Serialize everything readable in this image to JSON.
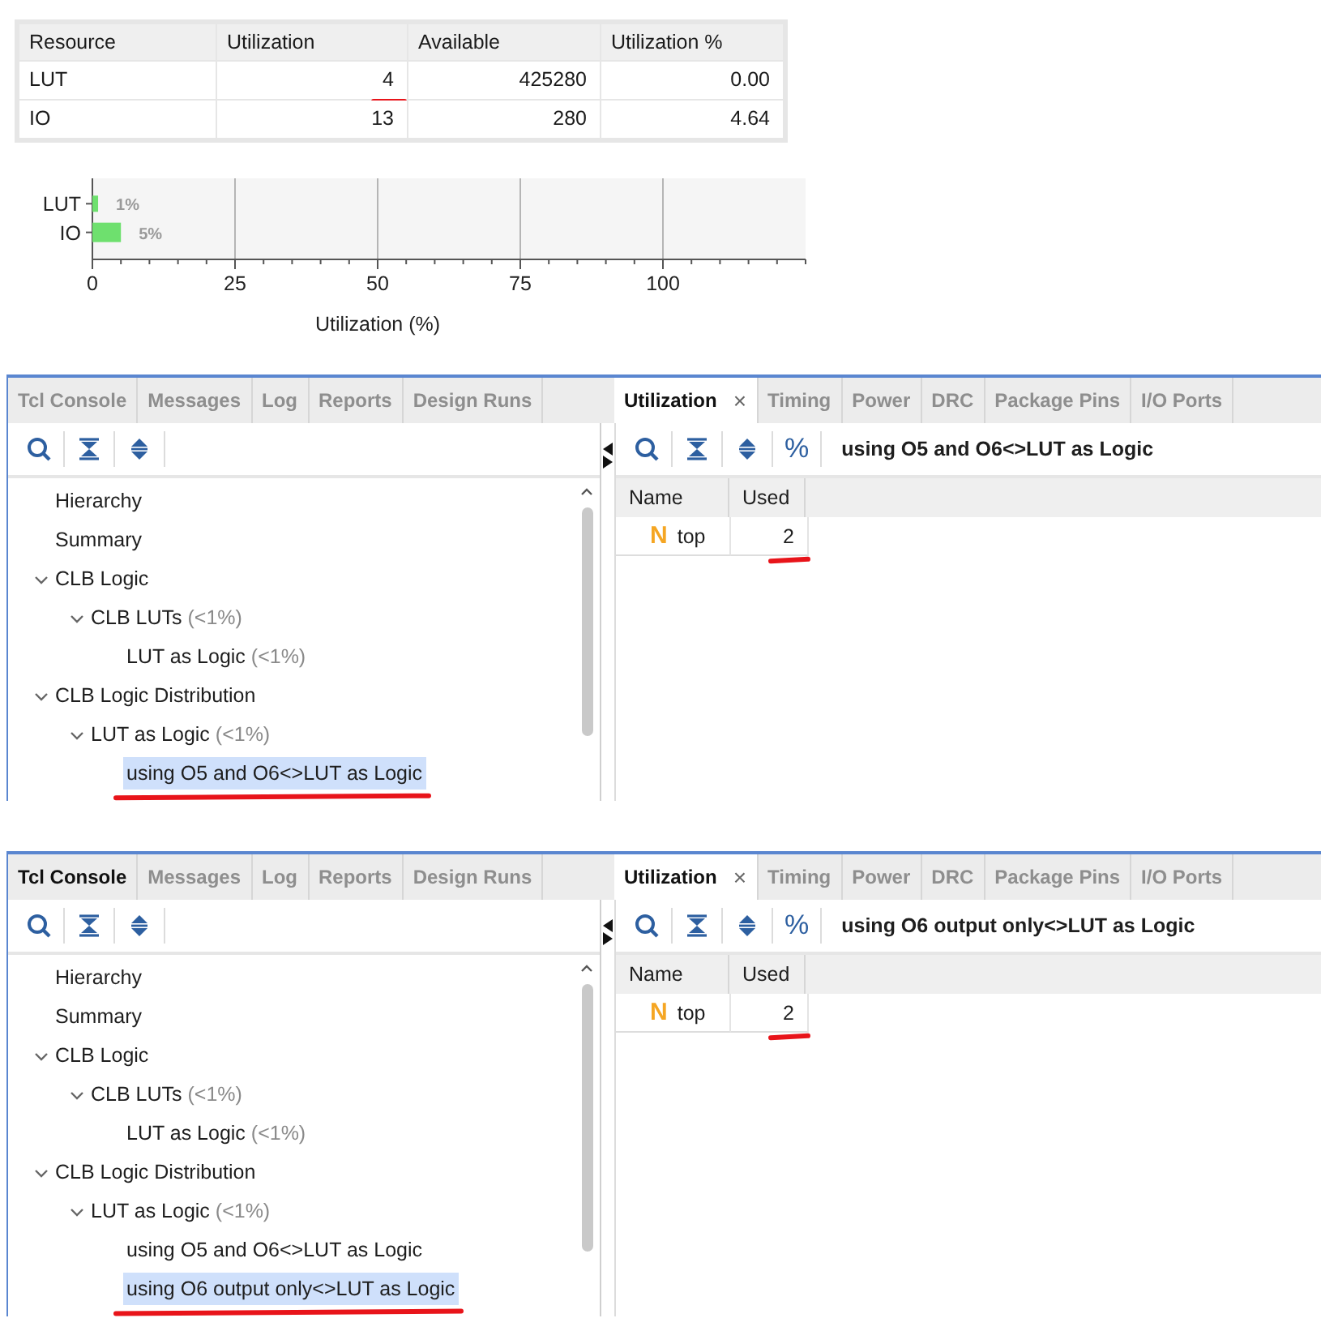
{
  "resource_table": {
    "columns": [
      "Resource",
      "Utilization",
      "Available",
      "Utilization %"
    ],
    "rows": [
      {
        "resource": "LUT",
        "utilization": "4",
        "available": "425280",
        "percent": "0.00",
        "utilization_underlined": true
      },
      {
        "resource": "IO",
        "utilization": "13",
        "available": "280",
        "percent": "4.64",
        "utilization_underlined": false
      }
    ]
  },
  "chart": {
    "chart_data": {
      "type": "bar",
      "orientation": "horizontal",
      "categories": [
        "LUT",
        "IO"
      ],
      "values": [
        1,
        5
      ],
      "grid": true,
      "value_labels": [
        "1%",
        "5%"
      ],
      "xlabel": "Utilization (%)",
      "xlim": [
        0,
        125
      ],
      "xticks": [
        0,
        25,
        50,
        75,
        100
      ]
    }
  },
  "panels": [
    {
      "left_tabs": [
        {
          "label": "Tcl Console",
          "selected": false,
          "highlighted": false
        },
        {
          "label": "Messages",
          "selected": false,
          "highlighted": false
        },
        {
          "label": "Log",
          "selected": false,
          "highlighted": false
        },
        {
          "label": "Reports",
          "selected": false,
          "highlighted": false
        },
        {
          "label": "Design Runs",
          "selected": false,
          "highlighted": false
        }
      ],
      "right_tabs": [
        {
          "label": "Utilization",
          "selected": true,
          "highlighted": true,
          "close": "×"
        },
        {
          "label": "Timing",
          "selected": false,
          "highlighted": false
        },
        {
          "label": "Power",
          "selected": false,
          "highlighted": false
        },
        {
          "label": "DRC",
          "selected": false,
          "highlighted": false
        },
        {
          "label": "Package Pins",
          "selected": false,
          "highlighted": false
        },
        {
          "label": "I/O Ports",
          "selected": false,
          "highlighted": false
        }
      ],
      "tree": [
        {
          "label": "Hierarchy",
          "selected": false,
          "underlined": false
        },
        {
          "label": "Summary",
          "selected": false,
          "underlined": false
        },
        {
          "label": "CLB Logic",
          "expanded": true,
          "selected": false,
          "underlined": false,
          "children": [
            {
              "label": "CLB LUTs",
              "note": "(<1%)",
              "expanded": true,
              "selected": false,
              "underlined": false,
              "children": [
                {
                  "label": "LUT as Logic",
                  "note": "(<1%)",
                  "selected": false,
                  "underlined": false
                }
              ]
            }
          ]
        },
        {
          "label": "CLB Logic Distribution",
          "expanded": true,
          "selected": false,
          "underlined": false,
          "children": [
            {
              "label": "LUT as Logic",
              "note": "(<1%)",
              "expanded": true,
              "selected": false,
              "underlined": false,
              "children": [
                {
                  "label": "using O5 and O6<>LUT as Logic",
                  "selected": true,
                  "underlined": true
                }
              ]
            }
          ]
        }
      ],
      "percent_button": "%",
      "title": "using O5 and O6<>LUT as Logic",
      "table": {
        "columns": [
          "Name",
          "Used"
        ],
        "rows": [
          {
            "icon": "N",
            "name": "top",
            "used": "2",
            "used_underlined": true
          }
        ]
      }
    },
    {
      "left_tabs": [
        {
          "label": "Tcl Console",
          "selected": false,
          "highlighted": true
        },
        {
          "label": "Messages",
          "selected": false,
          "highlighted": false
        },
        {
          "label": "Log",
          "selected": false,
          "highlighted": false
        },
        {
          "label": "Reports",
          "selected": false,
          "highlighted": false
        },
        {
          "label": "Design Runs",
          "selected": false,
          "highlighted": false
        }
      ],
      "right_tabs": [
        {
          "label": "Utilization",
          "selected": true,
          "highlighted": true,
          "close": "×"
        },
        {
          "label": "Timing",
          "selected": false,
          "highlighted": false
        },
        {
          "label": "Power",
          "selected": false,
          "highlighted": false
        },
        {
          "label": "DRC",
          "selected": false,
          "highlighted": false
        },
        {
          "label": "Package Pins",
          "selected": false,
          "highlighted": false
        },
        {
          "label": "I/O Ports",
          "selected": false,
          "highlighted": false
        }
      ],
      "tree": [
        {
          "label": "Hierarchy",
          "selected": false,
          "underlined": false
        },
        {
          "label": "Summary",
          "selected": false,
          "underlined": false
        },
        {
          "label": "CLB Logic",
          "expanded": true,
          "selected": false,
          "underlined": false,
          "children": [
            {
              "label": "CLB LUTs",
              "note": "(<1%)",
              "expanded": true,
              "selected": false,
              "underlined": false,
              "children": [
                {
                  "label": "LUT as Logic",
                  "note": "(<1%)",
                  "selected": false,
                  "underlined": false
                }
              ]
            }
          ]
        },
        {
          "label": "CLB Logic Distribution",
          "expanded": true,
          "selected": false,
          "underlined": false,
          "children": [
            {
              "label": "LUT as Logic",
              "note": "(<1%)",
              "expanded": true,
              "selected": false,
              "underlined": false,
              "children": [
                {
                  "label": "using O5 and O6<>LUT as Logic",
                  "selected": false,
                  "underlined": false
                },
                {
                  "label": "using O6 output only<>LUT as Logic",
                  "selected": true,
                  "underlined": true
                }
              ]
            }
          ]
        }
      ],
      "percent_button": "%",
      "title": "using O6 output only<>LUT as Logic",
      "table": {
        "columns": [
          "Name",
          "Used"
        ],
        "rows": [
          {
            "icon": "N",
            "name": "top",
            "used": "2",
            "used_underlined": true
          }
        ]
      }
    }
  ]
}
